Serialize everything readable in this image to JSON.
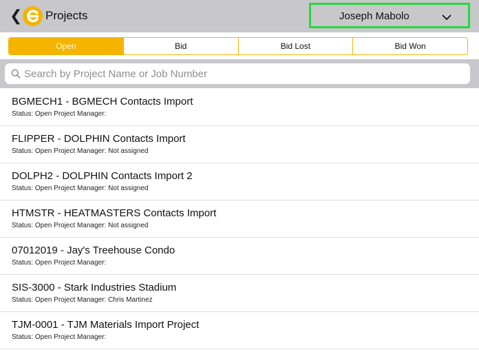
{
  "header": {
    "back_glyph": "❮",
    "logo_icon": "e-logo-icon",
    "title": "Projects",
    "user_name": "Joseph Mabolo",
    "dropdown_icon": "chevron-down-icon",
    "highlight_color": "#27d83a"
  },
  "tabs": [
    {
      "label": "Open",
      "active": true
    },
    {
      "label": "Bid",
      "active": false
    },
    {
      "label": "Bid Lost",
      "active": false
    },
    {
      "label": "Bid Won",
      "active": false
    }
  ],
  "search": {
    "placeholder": "Search by Project Name or Job Number",
    "value": "",
    "icon": "search-icon"
  },
  "projects": [
    {
      "name": "BGMECH1 - BGMECH Contacts Import",
      "status": "Status: Open Project Manager:"
    },
    {
      "name": "FLIPPER - DOLPHIN Contacts Import",
      "status": "Status: Open Project Manager: Not assigned"
    },
    {
      "name": "DOLPH2 - DOLPHIN Contacts Import 2",
      "status": "Status: Open Project Manager: Not assigned"
    },
    {
      "name": "HTMSTR - HEATMASTERS Contacts Import",
      "status": "Status: Open Project Manager: Not assigned"
    },
    {
      "name": "07012019 - Jay's Treehouse Condo",
      "status": "Status: Open Project Manager:"
    },
    {
      "name": "SIS-3000 - Stark Industries Stadium",
      "status": "Status: Open Project Manager: Chris Martinez"
    },
    {
      "name": "TJM-0001 - TJM Materials Import Project",
      "status": "Status: Open Project Manager:"
    }
  ],
  "colors": {
    "accent": "#f4b400",
    "header_bg": "#c8c8cc",
    "divider": "#dcdcdf"
  }
}
